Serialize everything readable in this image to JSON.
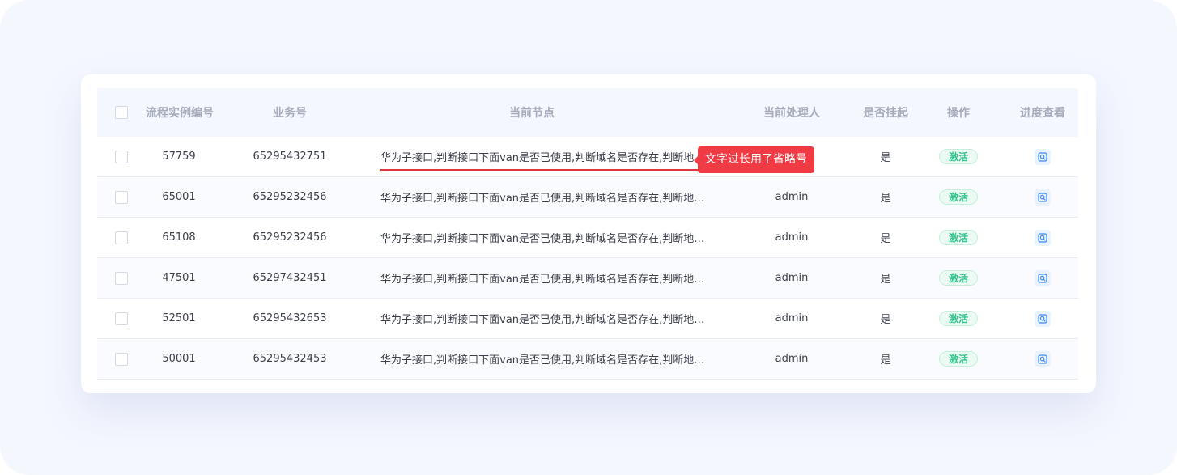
{
  "table": {
    "headers": {
      "id": "流程实例编号",
      "biz": "业务号",
      "node": "当前节点",
      "user": "当前处理人",
      "hang": "是否挂起",
      "op": "操作",
      "view": "进度查看"
    },
    "rows": [
      {
        "id": "57759",
        "biz": "65295432751",
        "node": "华为子接口,判断接口下面van是否已使用,判断域名是否存在,判断地址池是否存在",
        "user": "",
        "hang": "是",
        "op": "激活"
      },
      {
        "id": "65001",
        "biz": "65295232456",
        "node": "华为子接口,判断接口下面van是否已使用,判断域名是否存在,判断地址池是否存在",
        "user": "admin",
        "hang": "是",
        "op": "激活"
      },
      {
        "id": "65108",
        "biz": "65295232456",
        "node": "华为子接口,判断接口下面van是否已使用,判断域名是否存在,判断地址池是否存在",
        "user": "admin",
        "hang": "是",
        "op": "激活"
      },
      {
        "id": "47501",
        "biz": "65297432451",
        "node": "华为子接口,判断接口下面van是否已使用,判断域名是否存在,判断地址池是否存在",
        "user": "admin",
        "hang": "是",
        "op": "激活"
      },
      {
        "id": "52501",
        "biz": "65295432653",
        "node": "华为子接口,判断接口下面van是否已使用,判断域名是否存在,判断地址池是否存在",
        "user": "admin",
        "hang": "是",
        "op": "激活"
      },
      {
        "id": "50001",
        "biz": "65295432453",
        "node": "华为子接口,判断接口下面van是否已使用,判断域名是否存在,判断地址池是否存在",
        "user": "admin",
        "hang": "是",
        "op": "激活"
      }
    ]
  },
  "annotation": {
    "text": "文字过长用了省略号"
  },
  "icons": {
    "view": "search-eye-icon"
  },
  "colors": {
    "background": "#f5f7fe",
    "header_bg": "#f4f7fe",
    "header_text": "#a5abb8",
    "tag_green": "#33c38b",
    "annotation_red": "#f03a44",
    "view_blue": "#3d8bf2"
  }
}
